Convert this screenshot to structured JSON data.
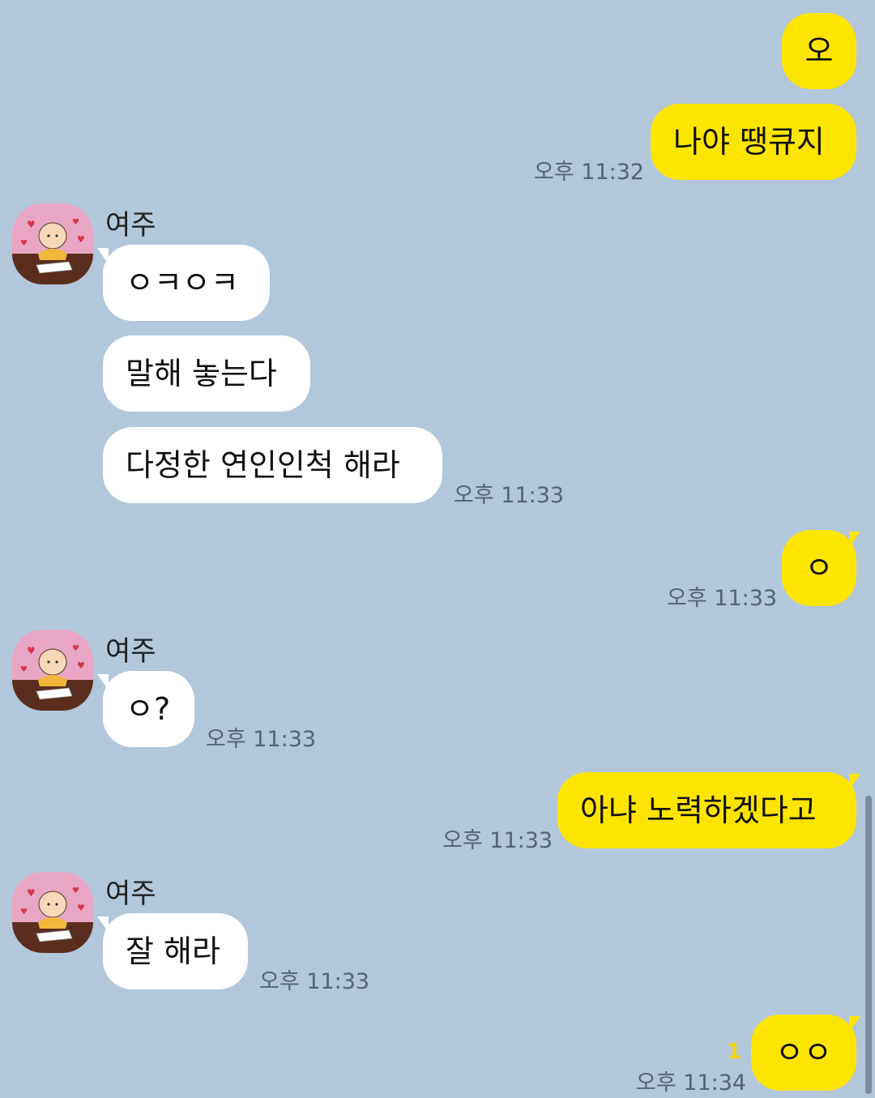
{
  "colors": {
    "background": "#b2c7da",
    "my_bubble": "#fee500",
    "their_bubble": "#ffffff",
    "unread_count": "#f5d400"
  },
  "messages": {
    "m1": {
      "text": "오"
    },
    "m2": {
      "text": "나야 땡큐지",
      "time": "오후 11:32"
    },
    "g1": {
      "sender": "여주",
      "avatar_icon": "cartoon-character-avatar",
      "texts": [
        "ㅇㅋㅇㅋ",
        "말해 놓는다",
        "다정한 연인인척 해라"
      ],
      "time": "오후 11:33"
    },
    "m3": {
      "text": "ㅇ",
      "time": "오후 11:33"
    },
    "g2": {
      "sender": "여주",
      "text": "ㅇ?",
      "time": "오후 11:33"
    },
    "m4": {
      "text": "아냐 노력하겠다고",
      "time": "오후 11:33"
    },
    "g3": {
      "sender": "여주",
      "text": "잘 해라",
      "time": "오후 11:33"
    },
    "m5": {
      "text": "ㅇㅇ",
      "time": "오후 11:34",
      "unread": "1"
    }
  }
}
